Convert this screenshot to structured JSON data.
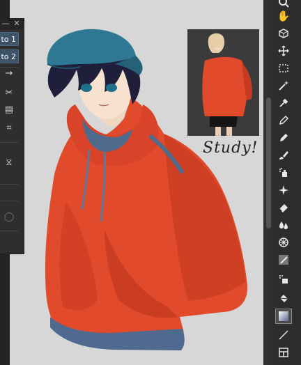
{
  "canvas": {
    "study_note": "Study!"
  },
  "float_panel": {
    "buttons": [
      {
        "label": "to 1"
      },
      {
        "label": "to 2"
      }
    ],
    "controls": {
      "minimize": "—",
      "close": "✕"
    }
  },
  "toolbar": {
    "tools": [
      {
        "name": "magnifier"
      },
      {
        "name": "hand"
      },
      {
        "name": "rotate-3d"
      },
      {
        "name": "move"
      },
      {
        "name": "rectangle-select"
      },
      {
        "name": "magic-wand"
      },
      {
        "name": "eyedropper"
      },
      {
        "name": "pen"
      },
      {
        "name": "pencil"
      },
      {
        "name": "brush"
      },
      {
        "name": "airbrush"
      },
      {
        "name": "decoration-sparkle"
      },
      {
        "name": "eraser"
      },
      {
        "name": "blend-drops"
      },
      {
        "name": "figure"
      },
      {
        "name": "vector"
      },
      {
        "name": "fill-bucket-spray"
      },
      {
        "name": "fill-bucket"
      },
      {
        "name": "gradient",
        "active": true
      },
      {
        "name": "line"
      },
      {
        "name": "frame"
      }
    ]
  },
  "colors": {
    "hoodie": "#e14b2b",
    "cap": "#2f7893",
    "canvas_bg": "#d7d7d7",
    "ui_dark": "#2d2d2d",
    "panel_button": "#3d5368"
  }
}
